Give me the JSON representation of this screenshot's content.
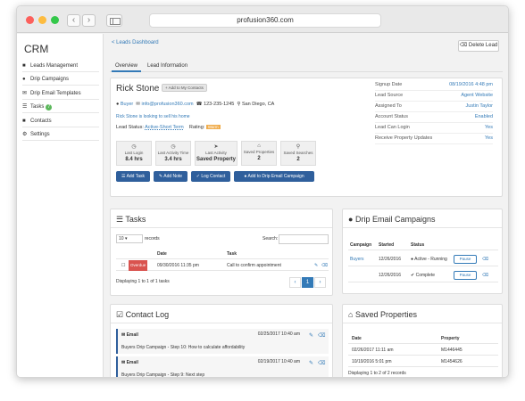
{
  "browser": {
    "url": "profusion360.com",
    "colors": {
      "close": "#fc605c",
      "minimize": "#fdbc40",
      "zoom": "#34c84a"
    }
  },
  "sidebar": {
    "title": "CRM",
    "items": [
      {
        "label": "Leads Management",
        "icon": "users-icon"
      },
      {
        "label": "Drip Campaigns",
        "icon": "drop-icon"
      },
      {
        "label": "Drip Email Templates",
        "icon": "envelope-icon"
      },
      {
        "label": "Tasks",
        "icon": "list-icon",
        "badge": "7"
      },
      {
        "label": "Contacts",
        "icon": "group-icon"
      },
      {
        "label": "Settings",
        "icon": "gear-icon"
      }
    ]
  },
  "header": {
    "breadcrumb": "< Leads Dashboard",
    "delete_label": "Delete Lead"
  },
  "tabs": [
    {
      "label": "Overview"
    },
    {
      "label": "Lead Information"
    }
  ],
  "lead": {
    "name": "Rick Stone",
    "add_contacts": "Add to My Contacts",
    "type": "Buyer",
    "email": "info@profusion360.com",
    "phone": "123-235-1245",
    "location": "San Diego, CA",
    "note": "Rick Stone is looking to sell his home",
    "status_label": "Lead Status:",
    "status_value": "Active-Short Term",
    "rating_label": "Rating:",
    "rating_value": "Warm",
    "stats": [
      {
        "label": "Last Login",
        "value": "8.4 hrs",
        "icon": "clock-icon"
      },
      {
        "label": "Last Activity Time",
        "value": "3.4 hrs",
        "icon": "clock-icon"
      },
      {
        "label": "Last Activity",
        "value": "Saved Property",
        "icon": "cursor-icon"
      },
      {
        "label": "Saved Properties",
        "value": "2",
        "icon": "home-icon"
      },
      {
        "label": "Saved Searches",
        "value": "2",
        "icon": "search-icon"
      }
    ],
    "actions": [
      {
        "label": "Add Task",
        "icon": "list-icon"
      },
      {
        "label": "Add Note",
        "icon": "pencil-icon"
      },
      {
        "label": "Log Contact",
        "icon": "check-icon"
      },
      {
        "label": "Add to Drip Email Campaign",
        "icon": "drop-icon"
      }
    ],
    "details": [
      {
        "label": "Signup Date",
        "value": "08/19/2016 4:48 pm"
      },
      {
        "label": "Lead Source",
        "value": "Agent Website"
      },
      {
        "label": "Assigned To",
        "value": "Justin Taylor"
      },
      {
        "label": "Account Status",
        "value": "Enabled"
      },
      {
        "label": "Lead Can Login",
        "value": "Yes"
      },
      {
        "label": "Receive Property Updates",
        "value": "Yes"
      }
    ]
  },
  "tasks": {
    "title": "Tasks",
    "page_size": "10",
    "records_label": "records",
    "search_label": "Search:",
    "columns": [
      "Date",
      "Task"
    ],
    "rows": [
      {
        "status": "Overdue",
        "date": "09/30/2016 11:35 pm",
        "task": "Call to confirm appointment"
      }
    ],
    "footer": "Displaying 1 to 1 of 1 tasks",
    "page": "1"
  },
  "drip": {
    "title": "Drip Email Campaigns",
    "columns": [
      "Campaign",
      "Started",
      "Status"
    ],
    "rows": [
      {
        "campaign": "Buyers",
        "started": "12/26/2016",
        "status": "Active - Running",
        "action": "Pause"
      },
      {
        "campaign": "",
        "started": "12/26/2016",
        "status": "Complete",
        "action": "Pause"
      }
    ]
  },
  "contact_log": {
    "title": "Contact Log",
    "entries": [
      {
        "type": "Email",
        "date": "02/25/2017 10:40 am",
        "desc": "Buyers Drip Campaign - Step 10: How to calculate affordability"
      },
      {
        "type": "Email",
        "date": "02/19/2017 10:40 am",
        "desc": "Buyers Drip Campaign - Step 9: Next step"
      }
    ]
  },
  "saved_properties": {
    "title": "Saved Properties",
    "columns": [
      "Date",
      "Property"
    ],
    "rows": [
      {
        "date": "02/26/2017 11:11 am",
        "property": "M1446445"
      },
      {
        "date": "10/19/2016 5:01 pm",
        "property": "M1454626"
      }
    ],
    "footer": "Displaying 1 to 2 of 2 records",
    "page": "1"
  }
}
